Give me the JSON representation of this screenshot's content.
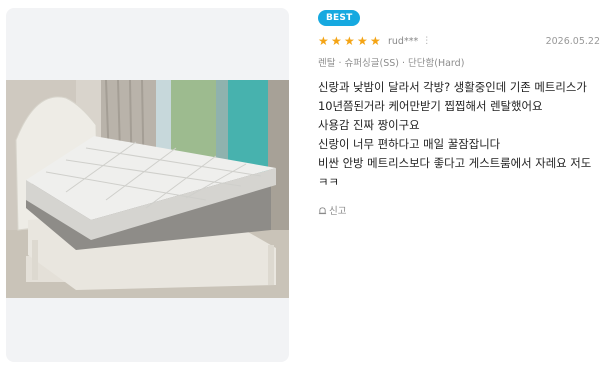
{
  "review": {
    "badge": "BEST",
    "rating": 5,
    "user": "rud***",
    "date": "2026.05.22",
    "option": "렌탈 · 슈퍼싱글(SS) · 단단함(Hard)",
    "lines": [
      "신랑과 낮밤이 달라서 각방? 생활중인데 기존 메트리스가",
      "10년쯤된거라 케어만받기 찝찝해서 렌탈했어요",
      "사용감 진짜 짱이구요",
      "신랑이 너무 편하다고 매일 꿀잠잡니다",
      "비싼 안방 메트리스보다 좋다고 게스트룸에서 자레요 저도",
      "ㅋㅋ"
    ],
    "report_label": "신고"
  },
  "icons": {
    "star": "star-icon",
    "more": "more-vertical-icon",
    "report": "siren-icon"
  },
  "colors": {
    "badge": "#16a9e0",
    "star": "#f4a415",
    "muted": "#8d8d8d"
  }
}
